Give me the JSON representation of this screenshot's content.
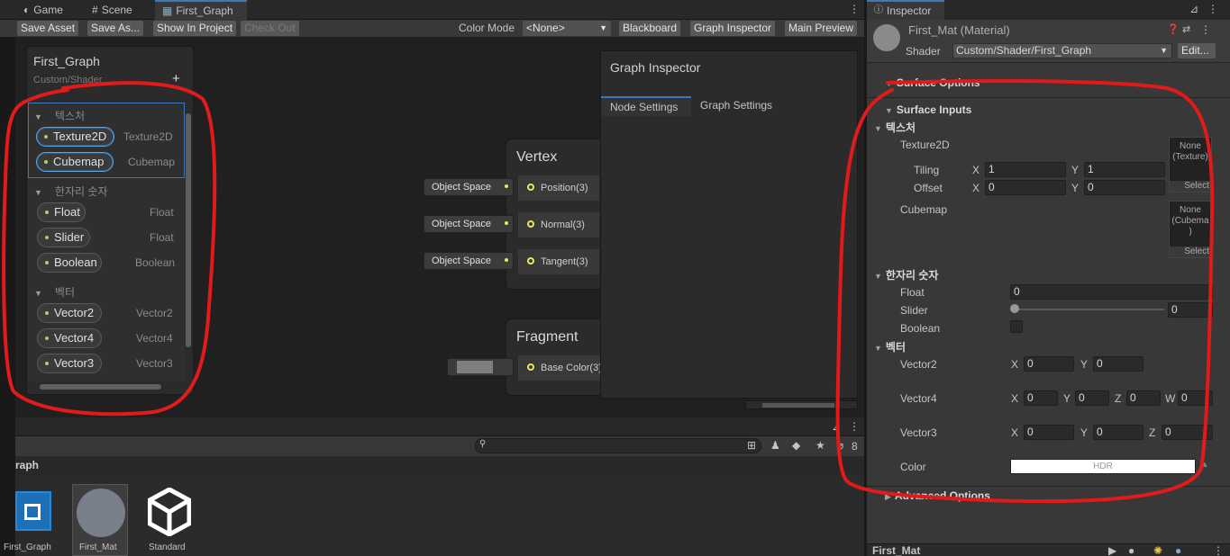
{
  "tabs": {
    "game": "Game",
    "scene": "Scene",
    "graph": "First_Graph",
    "inspector": "Inspector"
  },
  "toolbar": {
    "save_asset": "Save Asset",
    "save_as": "Save As...",
    "show_in_project": "Show In Project",
    "check_out": "Check Out",
    "color_mode_label": "Color Mode",
    "color_mode_value": "<None>",
    "blackboard": "Blackboard",
    "graph_inspector": "Graph Inspector",
    "main_preview": "Main Preview"
  },
  "blackboard": {
    "title": "First_Graph",
    "subtitle": "Custom/Shader",
    "add": "+",
    "sections": [
      {
        "name": "텍스처",
        "props": [
          {
            "label": "Texture2D",
            "type": "Texture2D"
          },
          {
            "label": "Cubemap",
            "type": "Cubemap"
          }
        ]
      },
      {
        "name": "한자리 숫자",
        "props": [
          {
            "label": "Float",
            "type": "Float"
          },
          {
            "label": "Slider",
            "type": "Float"
          },
          {
            "label": "Boolean",
            "type": "Boolean"
          }
        ]
      },
      {
        "name": "벡터",
        "props": [
          {
            "label": "Vector2",
            "type": "Vector2"
          },
          {
            "label": "Vector4",
            "type": "Vector4"
          },
          {
            "label": "Vector3",
            "type": "Vector3"
          }
        ]
      }
    ]
  },
  "vertex": {
    "title": "Vertex",
    "ports": [
      "Position(3)",
      "Normal(3)",
      "Tangent(3)"
    ],
    "input": "Object Space"
  },
  "fragment": {
    "title": "Fragment",
    "ports": [
      "Base Color(3)"
    ]
  },
  "graph_inspector": {
    "title": "Graph Inspector",
    "tab_node": "Node Settings",
    "tab_graph": "Graph Settings"
  },
  "project": {
    "breadcrumb": "raph",
    "count": "8",
    "assets": [
      "First_Graph",
      "First_Mat",
      "Standard"
    ]
  },
  "inspector": {
    "material": "First_Mat (Material)",
    "shader_label": "Shader",
    "shader_value": "Custom/Shader/First_Graph",
    "edit": "Edit...",
    "surface_options": "Surface Options",
    "surface_inputs": "Surface Inputs",
    "sec_tex": "텍스처",
    "texture2d": "Texture2D",
    "tiling": "Tiling",
    "offset": "Offset",
    "x": "X",
    "y": "Y",
    "z": "Z",
    "w": "W",
    "tiling_x": "1",
    "tiling_y": "1",
    "offset_x": "0",
    "offset_y": "0",
    "tex_none": "None (Texture)",
    "cubemap": "Cubemap",
    "cube_none": "None (Cubema )",
    "select": "Select",
    "sec_num": "한자리 숫자",
    "float": "Float",
    "float_val": "0",
    "slider": "Slider",
    "slider_val": "0",
    "boolean": "Boolean",
    "sec_vec": "벡터",
    "vector2": "Vector2",
    "vector4": "Vector4",
    "vector3": "Vector3",
    "zero": "0",
    "color": "Color",
    "hdr": "HDR",
    "advanced": "Advanced Options",
    "footer": "First_Mat"
  },
  "colors": {
    "accent": "#3a79bb",
    "annotation": "#e01b1b"
  }
}
